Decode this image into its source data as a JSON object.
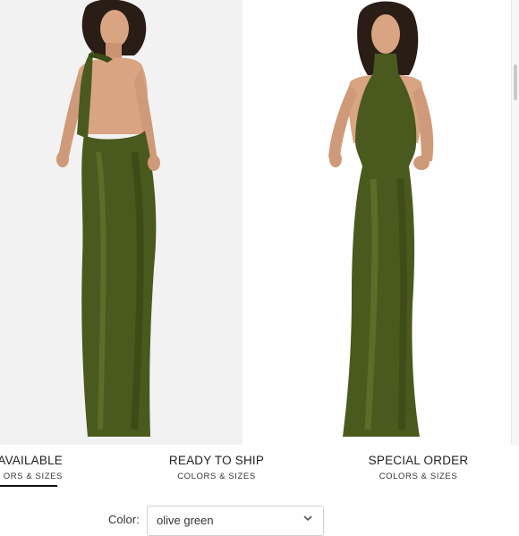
{
  "gallery": {
    "images": [
      {
        "alt": "Back view of olive satin halter maxi dress"
      },
      {
        "alt": "Front view of olive satin halter maxi dress"
      }
    ]
  },
  "tabs": [
    {
      "title": "AVAILABLE",
      "sub": "ORS & SIZES",
      "selected": true
    },
    {
      "title": "READY TO SHIP",
      "sub": "COLORS & SIZES",
      "selected": false
    },
    {
      "title": "SPECIAL ORDER",
      "sub": "COLORS & SIZES",
      "selected": false
    }
  ],
  "color": {
    "label": "Color:",
    "value": "olive green"
  },
  "colors": {
    "dress": "#4a5a1e",
    "dress_shadow": "#2f3a10",
    "dress_highlight": "#6b7c33",
    "skin": "#d9a482",
    "hair": "#2a1d16",
    "back_bg": "#f2f2f2"
  }
}
